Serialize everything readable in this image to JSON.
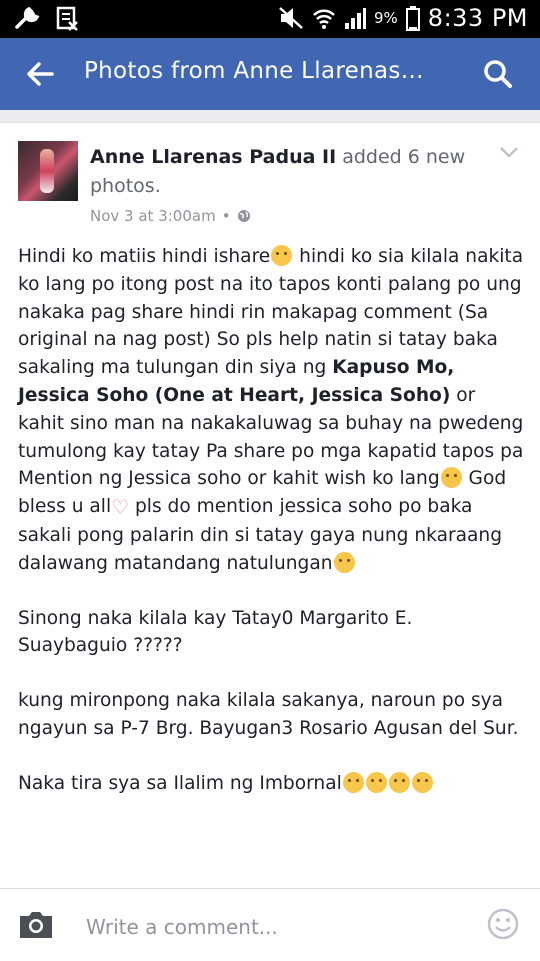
{
  "status_bar": {
    "battery_pct": "9%",
    "time": "8:33 PM"
  },
  "app_bar": {
    "title": "Photos from Anne Llarenas…"
  },
  "post": {
    "author": "Anne Llarenas Padua II",
    "action": " added 6 new photos.",
    "timestamp": "Nov 3 at 3:00am",
    "audience_icon": "globe-icon",
    "paragraphs": {
      "p1a": "Hindi ko matiis hindi ishare",
      "p1b": " hindi ko sia kilala nakita ko lang po itong post na ito tapos konti palang po ung nakaka pag share hindi rin makapag comment (Sa original na nag post) So pls help natin si tatay baka sakaling ma tulungan din siya ng ",
      "p1c": "Kapuso Mo, Jessica Soho (One at Heart, Jessica Soho)",
      "p1d": " or kahit sino man na nakakaluwag sa buhay na pwedeng tumulong kay tatay   Pa share po mga kapatid tapos pa Mention ng Jessica soho or kahit wish ko lang",
      "p1e": " God bless u all",
      "p1f": " pls do mention jessica soho po baka sakali pong palarin din si tatay gaya nung nkaraang dalawang matandang natulungan",
      "p2": "Sinong naka kilala kay Tatay0 Margarito E. Suaybaguio ?????",
      "p3": "kung mironpong naka kilala sakanya, naroun po sya ngayun sa P-7 Brg. Bayugan3 Rosario Agusan del Sur.",
      "p4": "Naka tira sya sa Ilalim ng Imbornal"
    }
  },
  "comment_bar": {
    "placeholder": "Write a comment..."
  },
  "colors": {
    "app_bar": "#4267b2",
    "status_bar": "#000000",
    "background": "#e9ebee",
    "muted_text": "#90949c"
  }
}
